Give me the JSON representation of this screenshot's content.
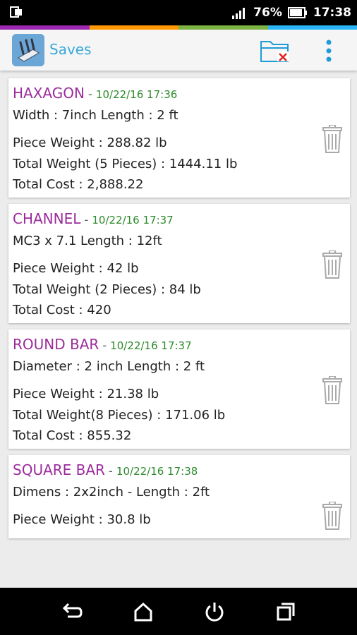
{
  "status_bar": {
    "battery_percent": "76%",
    "time": "17:38",
    "left_icon": "screen-mirror-icon"
  },
  "colors": {
    "accent_stripe": [
      "#9c27b0",
      "#ff9800",
      "#7cb342",
      "#29b6f6"
    ],
    "title_color": "#3aa8d8",
    "item_type_color": "#9c2c9c",
    "date_color": "#2d8a2d"
  },
  "app_bar": {
    "title": "Saves",
    "delete_all_icon": "folder-delete-icon",
    "menu_icon": "overflow-menu-icon"
  },
  "items": [
    {
      "type": "HAXAGON",
      "separator": "-",
      "date": "10/22/16 17:36",
      "dimensions": "Width : 7inch Length : 2 ft",
      "piece_weight": "Piece Weight : 288.82 lb",
      "total_weight": "Total Weight (5 Pieces) : 1444.11 lb",
      "total_cost": "Total Cost : 2,888.22"
    },
    {
      "type": "CHANNEL",
      "separator": "-",
      "date": "10/22/16 17:37",
      "dimensions": "MC3 x 7.1 Length : 12ft",
      "piece_weight": "Piece Weight : 42 lb",
      "total_weight": "Total Weight (2 Pieces) : 84 lb",
      "total_cost": "Total Cost : 420"
    },
    {
      "type": "ROUND BAR",
      "separator": "-",
      "date": "10/22/16 17:37",
      "dimensions": "Diameter : 2 inch Length : 2 ft",
      "piece_weight": "Piece Weight : 21.38 lb",
      "total_weight": "Total Weight(8 Pieces) : 171.06 lb",
      "total_cost": "Total Cost : 855.32"
    },
    {
      "type": "SQUARE BAR",
      "separator": "-",
      "date": "10/22/16 17:38",
      "dimensions": "Dimens : 2x2inch - Length : 2ft",
      "piece_weight": "Piece Weight : 30.8 lb"
    }
  ],
  "nav_bar": {
    "icons": [
      "back-icon",
      "home-icon",
      "power-icon",
      "recents-icon"
    ]
  }
}
